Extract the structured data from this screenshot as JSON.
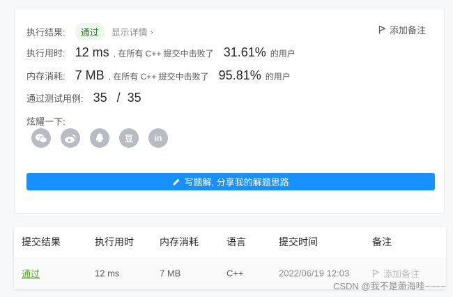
{
  "summary": {
    "result_label": "执行结果:",
    "result_status": "通过",
    "details_link": "显示详情",
    "add_note": "添加备注",
    "runtime": {
      "label": "执行用时:",
      "value": "12 ms",
      "prefix": ", 在所有 C++ 提交中击败了",
      "percent": "31.61%",
      "suffix": "的用户"
    },
    "memory": {
      "label": "内存消耗:",
      "value": "7 MB",
      "prefix": ", 在所有 C++ 提交中击败了",
      "percent": "95.81%",
      "suffix": "的用户"
    },
    "testcases": {
      "label": "通过测试用例:",
      "passed": "35",
      "separator": "/",
      "total": "35"
    },
    "share_label": "炫耀一下:",
    "share_icons": [
      "wechat-icon",
      "weibo-icon",
      "qq-icon",
      "douban-icon",
      "linkedin-icon"
    ],
    "douban_glyph": "豆",
    "linkedin_glyph": "in",
    "write_solution_button": "写题解, 分享我的解题思路"
  },
  "submissions": {
    "headers": [
      "提交结果",
      "执行用时",
      "内存消耗",
      "语言",
      "提交时间",
      "备注"
    ],
    "rows": [
      {
        "result": "通过",
        "runtime": "12 ms",
        "memory": "7 MB",
        "language": "C++",
        "time": "2022/06/19 12:03",
        "note": "添加备注"
      }
    ]
  },
  "watermark": "CSDN @我不是萧海哇~~~~",
  "colors": {
    "accent": "#1890ff",
    "success": "#52a81a",
    "share_icon_bg": "#b8bcc2"
  }
}
